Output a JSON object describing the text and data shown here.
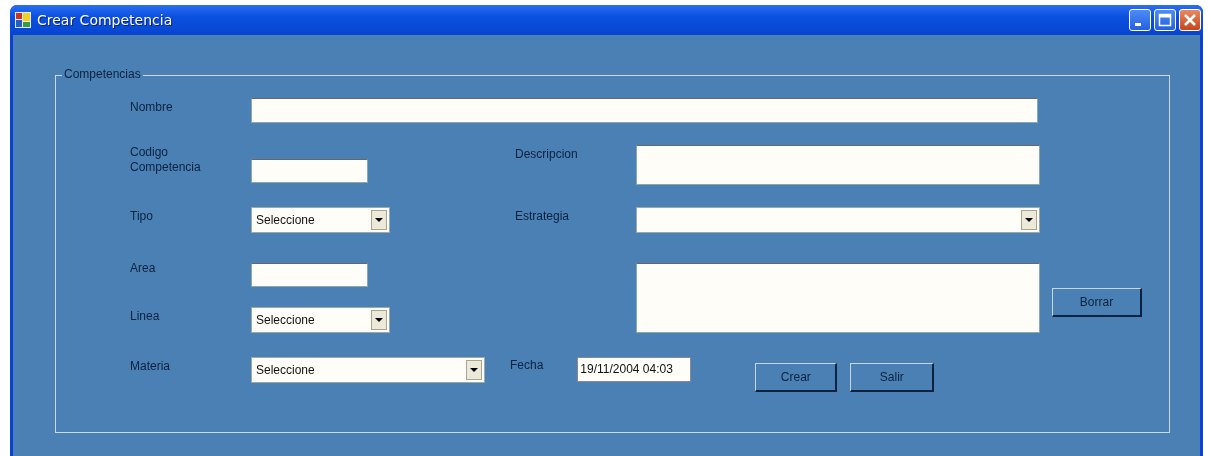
{
  "window": {
    "title": "Crear Competencia"
  },
  "group": {
    "title": "Competencias"
  },
  "fields": {
    "nombre": {
      "label": "Nombre"
    },
    "codigo": {
      "label": "Codigo Competencia"
    },
    "descripcion": {
      "label": "Descripcion"
    },
    "tipo": {
      "label": "Tipo",
      "value": "Seleccione"
    },
    "estrategia": {
      "label": "Estrategia"
    },
    "area": {
      "label": "Area"
    },
    "linea": {
      "label": "Linea",
      "value": "Seleccione"
    },
    "materia": {
      "label": "Materia",
      "value": "Seleccione"
    },
    "fecha": {
      "label": "Fecha",
      "value": "19/11/2004 04:03"
    }
  },
  "buttons": {
    "borrar": "Borrar",
    "crear": "Crear",
    "salir": "Salir"
  }
}
